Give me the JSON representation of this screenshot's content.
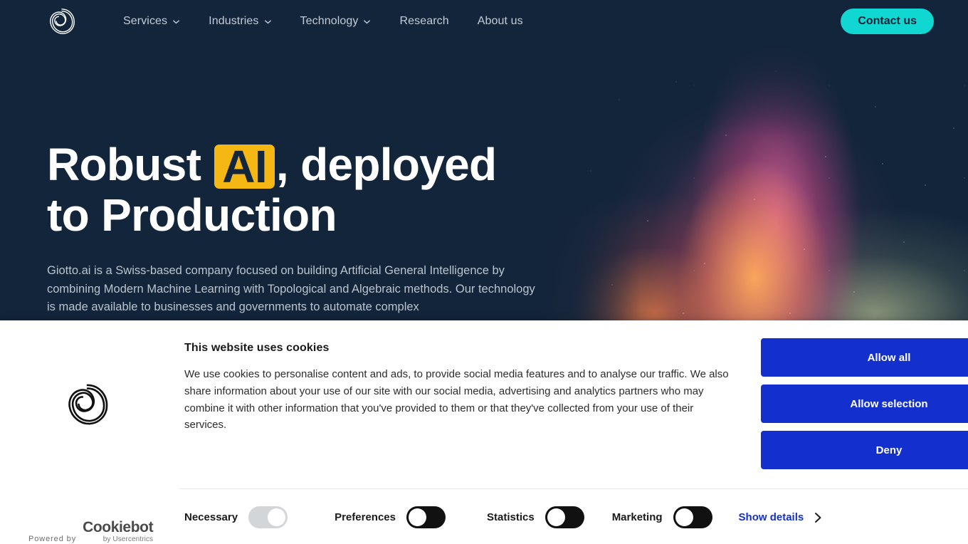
{
  "navbar": {
    "logo_icon": "giotto-spiral-logo",
    "items": [
      {
        "label": "Services",
        "has_dropdown": true
      },
      {
        "label": "Industries",
        "has_dropdown": true
      },
      {
        "label": "Technology",
        "has_dropdown": true
      },
      {
        "label": "Research",
        "has_dropdown": false
      },
      {
        "label": "About us",
        "has_dropdown": false
      }
    ],
    "contact_label": "Contact us",
    "bg_color": "#13253b",
    "contact_color": "#10d7d2"
  },
  "hero": {
    "headline_line1_pre": "Robust ",
    "headline_highlight": "AI",
    "headline_line1_post": ", deployed",
    "headline_line2": "to Production",
    "highlight_color": "#f5b713",
    "paragraph": "Giotto.ai is a Swiss-based company focused on building Artificial General Intelligence by combining Modern Machine Learning with Topological and Algebraic methods. Our technology is made available to businesses and governments to automate complex"
  },
  "cookie_banner": {
    "logo_icon": "giotto-spiral-logo",
    "title": "This website uses cookies",
    "body": "We use cookies to personalise content and ads, to provide social media features and to analyse our traffic. We also share information about your use of our site with our social media, advertising and analytics partners who may combine it with other information that you've provided to them or that they've collected from your use of their services.",
    "buttons": [
      {
        "label": "Allow all"
      },
      {
        "label": "Allow selection"
      },
      {
        "label": "Deny"
      }
    ],
    "button_color": "#1330ce",
    "categories": [
      {
        "label": "Necessary",
        "state": "locked-on"
      },
      {
        "label": "Preferences",
        "state": "off"
      },
      {
        "label": "Statistics",
        "state": "off"
      },
      {
        "label": "Marketing",
        "state": "off"
      }
    ],
    "show_details_label": "Show details",
    "show_details_icon": "chevron-right-icon",
    "powered_by_prefix": "Powered by",
    "powered_by_brand": "Cookiebot",
    "powered_by_sub": "by Usercentrics"
  }
}
